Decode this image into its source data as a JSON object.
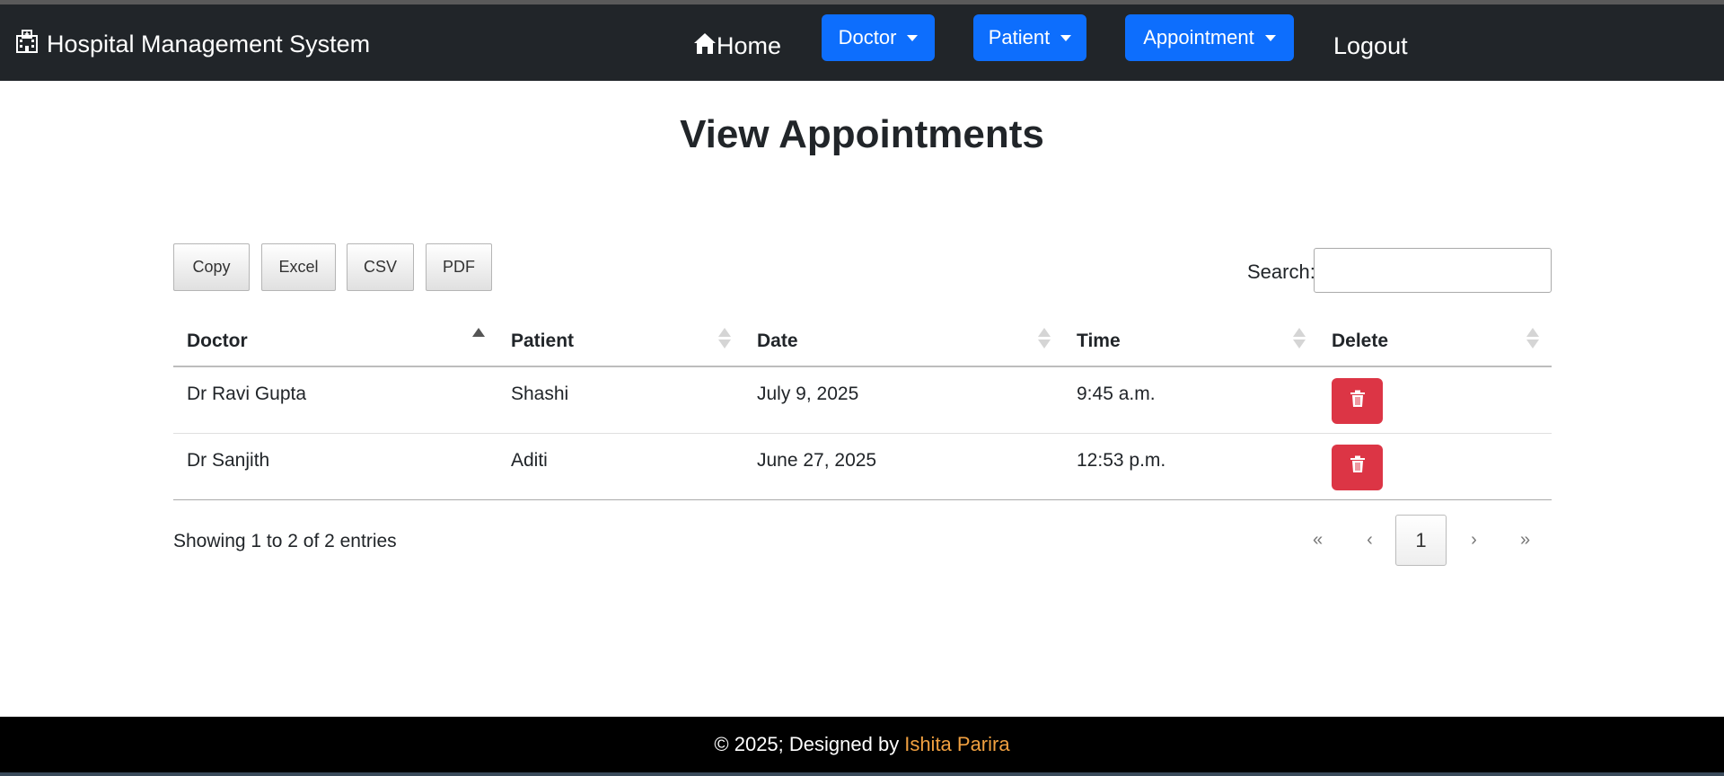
{
  "navbar": {
    "brand": "Hospital Management System",
    "brand_icon": "hospital-icon",
    "home_label": "Home",
    "home_icon": "house-icon",
    "menus": [
      {
        "label": "Doctor"
      },
      {
        "label": "Patient"
      },
      {
        "label": "Appointment"
      }
    ],
    "logout_label": "Logout",
    "accent_color": "#0d6efd",
    "background": "#212529"
  },
  "page": {
    "title": "View Appointments"
  },
  "export_buttons": [
    "Copy",
    "Excel",
    "CSV",
    "PDF"
  ],
  "search": {
    "label": "Search:",
    "value": ""
  },
  "table": {
    "columns": [
      "Doctor",
      "Patient",
      "Date",
      "Time",
      "Delete"
    ],
    "sorted_column": "Doctor",
    "sort_direction": "ascending",
    "rows": [
      {
        "doctor": "Dr Ravi Gupta",
        "patient": "Shashi",
        "date": "July 9, 2025",
        "time": "9:45 a.m."
      },
      {
        "doctor": "Dr Sanjith",
        "patient": "Aditi",
        "date": "June 27, 2025",
        "time": "12:53 p.m."
      }
    ],
    "delete_icon": "trash-icon",
    "delete_color": "#dc3545"
  },
  "pagination": {
    "info": "Showing 1 to 2 of 2 entries",
    "first": "«",
    "previous": "‹",
    "current_page": "1",
    "next": "›",
    "last": "»"
  },
  "footer": {
    "text": "© 2025; Designed by",
    "author": "Ishita Parira",
    "author_color": "#f0a040"
  }
}
